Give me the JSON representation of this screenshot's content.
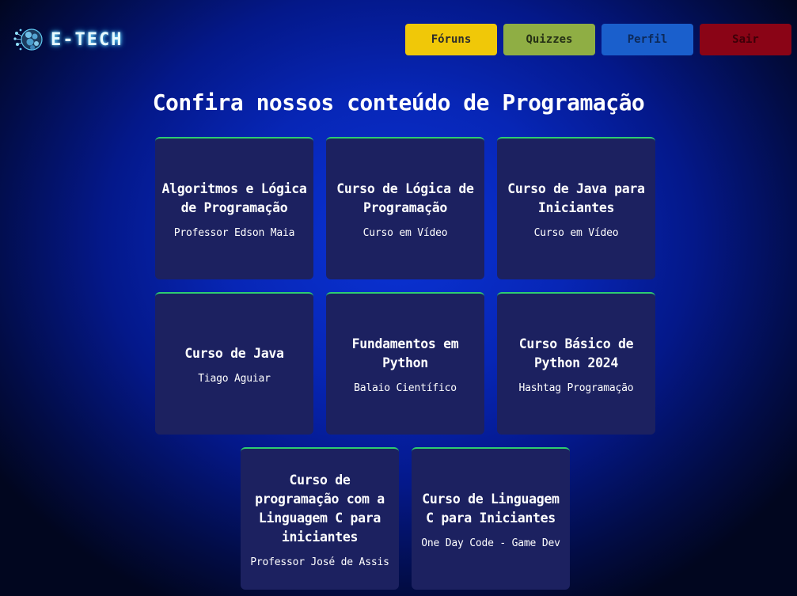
{
  "header": {
    "logo_text": "E-TECH",
    "logo_icon": "neural-network-icon",
    "nav": [
      {
        "label": "Fóruns",
        "color": "#f0c808"
      },
      {
        "label": "Quizzes",
        "color": "#8fae44"
      },
      {
        "label": "Perfil",
        "color": "#1a5fcc"
      },
      {
        "label": "Sair",
        "color": "#8a0416"
      }
    ]
  },
  "main": {
    "title": "Confira nossos conteúdo de Programação",
    "cards": [
      {
        "title": "Algoritmos e Lógica de Programação",
        "subtitle": "Professor Edson Maia"
      },
      {
        "title": "Curso de Lógica de Programação",
        "subtitle": "Curso em Vídeo"
      },
      {
        "title": "Curso de Java para Iniciantes",
        "subtitle": "Curso em Vídeo"
      },
      {
        "title": "Curso de Java",
        "subtitle": "Tiago Aguiar"
      },
      {
        "title": "Fundamentos em Python",
        "subtitle": "Balaio Científico"
      },
      {
        "title": "Curso Básico de Python 2024",
        "subtitle": "Hashtag Programação"
      },
      {
        "title": "Curso de programação com a Linguagem C para iniciantes",
        "subtitle": "Professor José de Assis"
      },
      {
        "title": "Curso de Linguagem C para Iniciantes",
        "subtitle": "One Day Code - Game Dev"
      }
    ]
  },
  "colors": {
    "card_bg": "#1c2160",
    "card_accent": "#2ecc71",
    "background": "#0726b6"
  }
}
